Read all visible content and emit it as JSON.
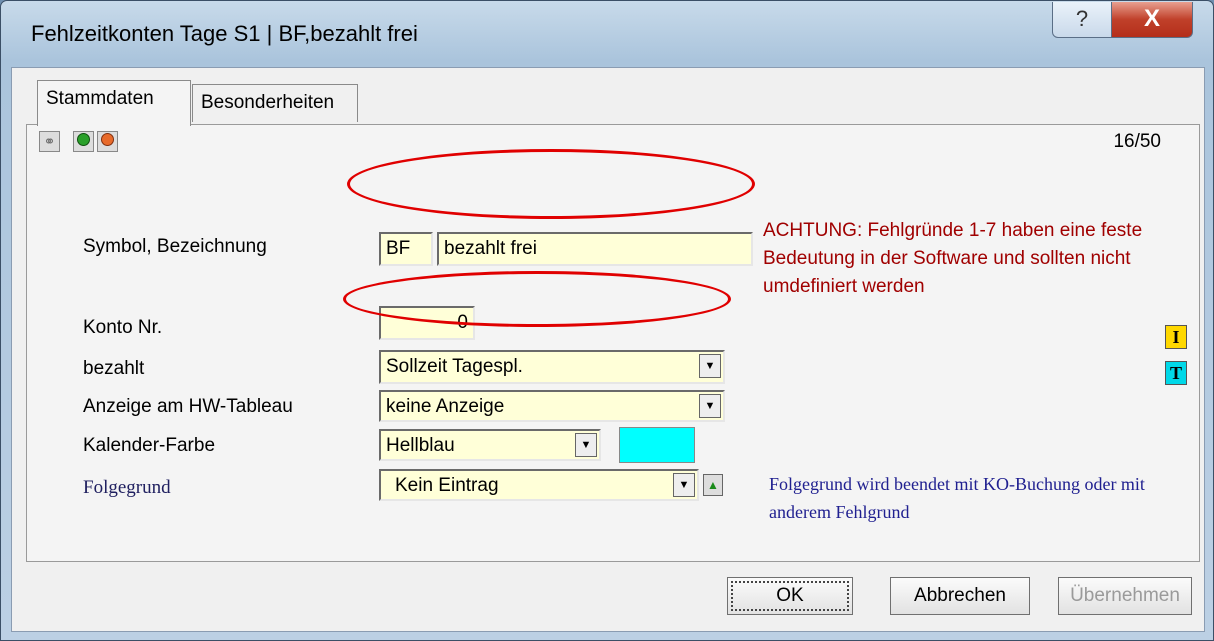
{
  "window": {
    "title": "Fehlzeitkonten Tage S1 | BF,bezahlt frei",
    "help_label": "?",
    "close_label": "X"
  },
  "tabs": [
    "Stammdaten",
    "Besonderheiten"
  ],
  "toolbar": {
    "icons": [
      "paperclip-icon",
      "green-circle-icon",
      "orange-circle-icon"
    ]
  },
  "counter": "16/50",
  "form": {
    "symbol_label": "Symbol, Bezeichnung",
    "symbol_value": "BF",
    "name_value": "bezahlt frei",
    "konto_label": "Konto Nr.",
    "konto_value": "0",
    "bezahlt_label": "bezahlt",
    "bezahlt_value": "Sollzeit Tagespl.",
    "anzeige_label": "Anzeige am HW-Tableau",
    "anzeige_value": "keine Anzeige",
    "farbe_label": "Kalender-Farbe",
    "farbe_value": "Hellblau",
    "farbe_color": "#00ffff",
    "folgegrund_label": "Folgegrund",
    "folgegrund_value": "Kein Eintrag"
  },
  "warning_text": "ACHTUNG: Fehlgründe 1-7 haben eine feste Bedeutung in der Software und sollten nicht umdefiniert werden",
  "folge_note": "Folgegrund wird beendet mit KO-Buchung oder mit anderem Fehlgrund",
  "side_buttons": [
    "I",
    "T"
  ],
  "buttons": {
    "ok": "OK",
    "cancel": "Abbrechen",
    "apply": "Übernehmen"
  }
}
